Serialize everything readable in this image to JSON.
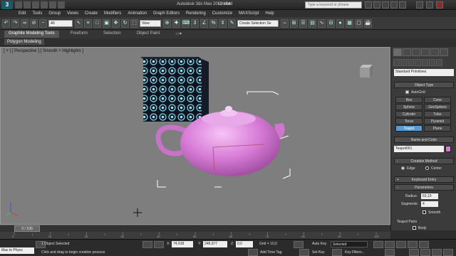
{
  "app": {
    "title": "Autodesk 3ds Max 2012 x64",
    "document": "Untitled",
    "search_placeholder": "Type a keyword or phrase"
  },
  "menu": [
    "Edit",
    "Tools",
    "Group",
    "Views",
    "Create",
    "Modifiers",
    "Animation",
    "Graph Editors",
    "Rendering",
    "Customize",
    "MAXScript",
    "Help"
  ],
  "toolbar": {
    "selection_filter": "All",
    "ref_coord": "View",
    "named_selection": "Create Selection Se"
  },
  "ribbon": {
    "tabs": [
      "Graphite Modeling Tools",
      "Freeform",
      "Selection",
      "Object Paint"
    ],
    "active_tab": "Graphite Modeling Tools",
    "panel": "Polygon Modeling"
  },
  "viewport": {
    "label": "[ + ] [ Perspective ] [ Smooth + Highlights ]"
  },
  "command_panel": {
    "category": "Standard Primitives",
    "object_type": {
      "header": "Object Type",
      "autogrid": "AutoGrid",
      "buttons": [
        "Box",
        "Cone",
        "Sphere",
        "GeoSphere",
        "Cylinder",
        "Tube",
        "Torus",
        "Pyramid",
        "Teapot",
        "Plane"
      ],
      "active": "Teapot"
    },
    "name_and_color": {
      "header": "Name and Color",
      "name": "Teapot001",
      "color": "#d67ad6"
    },
    "creation_method": {
      "header": "Creation Method",
      "options": [
        "Edge",
        "Center"
      ],
      "selected": "Center"
    },
    "keyboard_entry": {
      "header": "Keyboard Entry"
    },
    "parameters": {
      "header": "Parameters",
      "radius_label": "Radius:",
      "radius": "63,19",
      "segments_label": "Segments:",
      "segments": "4",
      "smooth_label": "Smooth",
      "teapot_parts_label": "Teapot Parts",
      "body_label": "Body"
    }
  },
  "timeline": {
    "frame": "0 / 100",
    "ticks": [
      "0",
      "10",
      "20",
      "30",
      "40",
      "50",
      "60",
      "70",
      "80",
      "90",
      "100"
    ]
  },
  "status": {
    "maxscript_text": "Max to Physc",
    "selected_text": "1 Object Selected",
    "prompt_text": "Click and drag to begin creation process",
    "x_label": "X:",
    "x_value": "74,918",
    "y_label": "Y:",
    "y_value": "248,977",
    "z_label": "Z:",
    "z_value": "0,0",
    "grid": "Grid = 10,0",
    "add_time_tag": "Add Time Tag",
    "auto_key": "Auto Key",
    "set_key": "Set Key",
    "key_mode": "Selected",
    "key_filters": "Key Filters..."
  },
  "colors": {
    "teapot": "#d67ad6",
    "viewport_bg": "#7e7e7e",
    "active_button": "#5b9bd5"
  }
}
